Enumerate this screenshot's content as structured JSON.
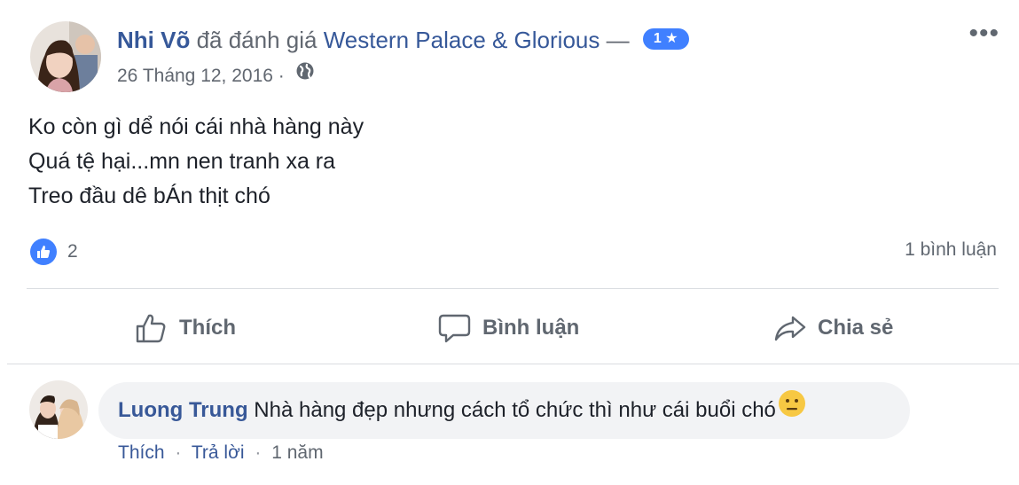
{
  "post": {
    "author": "Nhi Võ",
    "action_text": "đã đánh giá",
    "page": "Western Palace & Glorious",
    "dash": "—",
    "rating": "1 ★",
    "date": "26 Tháng 12, 2016",
    "dot": "·",
    "more": "•••",
    "body_lines": [
      "Ko còn gì dể nói cái nhà hàng này",
      "Quá tệ hại...mn nen tranh xa ra",
      "Treo đầu dê bÁn thịt chó"
    ],
    "like_count": "2",
    "comment_count": "1 bình luận"
  },
  "actions": {
    "like": "Thích",
    "comment": "Bình luận",
    "share": "Chia sẻ"
  },
  "comment": {
    "author": "Luong Trung",
    "text": "Nhà hàng đẹp nhưng cách tổ chức thì như cái buổi chó",
    "like_label": "Thích",
    "reply_label": "Trả lời",
    "time": "1 năm",
    "sep": "·"
  },
  "colors": {
    "link": "#365899",
    "badge": "#4080ff",
    "muted": "#616770",
    "bubble": "#f2f3f5"
  }
}
